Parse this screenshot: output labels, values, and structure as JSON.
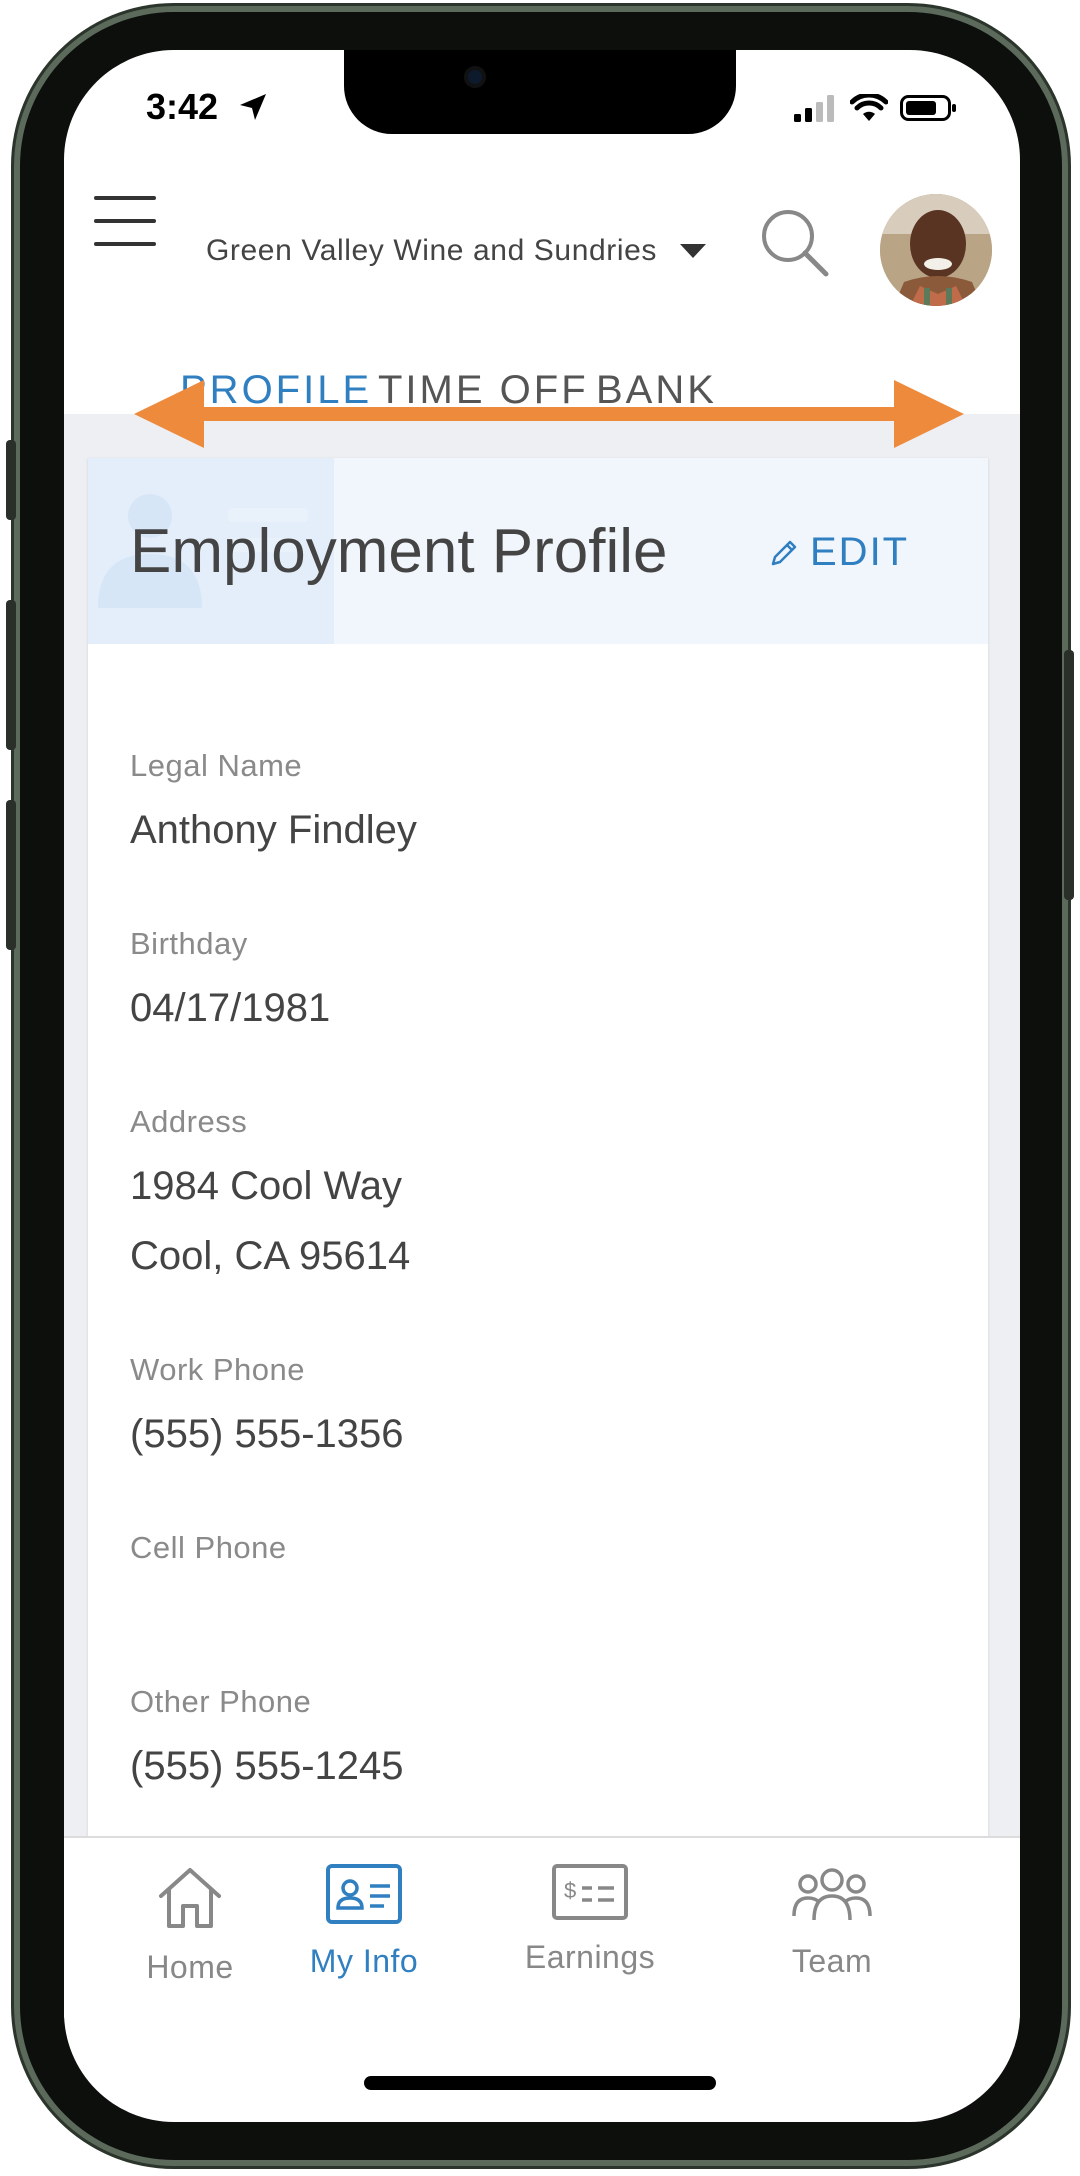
{
  "status_bar": {
    "time": "3:42"
  },
  "header": {
    "company_name": "Green Valley Wine and Sundries"
  },
  "tabs": [
    {
      "label": "PROFILE",
      "active": true
    },
    {
      "label": "TIME OFF",
      "active": false
    },
    {
      "label": "BANK",
      "active": false
    }
  ],
  "profile": {
    "title": "Employment Profile",
    "edit_label": "EDIT",
    "fields": [
      {
        "label": "Legal Name",
        "lines": [
          "Anthony Findley"
        ]
      },
      {
        "label": "Birthday",
        "lines": [
          "04/17/1981"
        ]
      },
      {
        "label": "Address",
        "lines": [
          "1984 Cool Way",
          "Cool, CA 95614"
        ]
      },
      {
        "label": "Work Phone",
        "lines": [
          "(555) 555-1356"
        ]
      },
      {
        "label": "Cell Phone",
        "lines": []
      },
      {
        "label": "Other Phone",
        "lines": [
          "(555) 555-1245"
        ]
      }
    ]
  },
  "tabbar": {
    "items": [
      {
        "label": "Home",
        "icon": "home-icon",
        "active": false
      },
      {
        "label": "My Info",
        "icon": "id-card-icon",
        "active": true
      },
      {
        "label": "Earnings",
        "icon": "check-icon",
        "active": false
      },
      {
        "label": "Team",
        "icon": "team-icon",
        "active": false
      }
    ]
  },
  "colors": {
    "accent": "#2f7fc1",
    "arrow": "#ee8a3c",
    "band": "#eeeff3"
  }
}
